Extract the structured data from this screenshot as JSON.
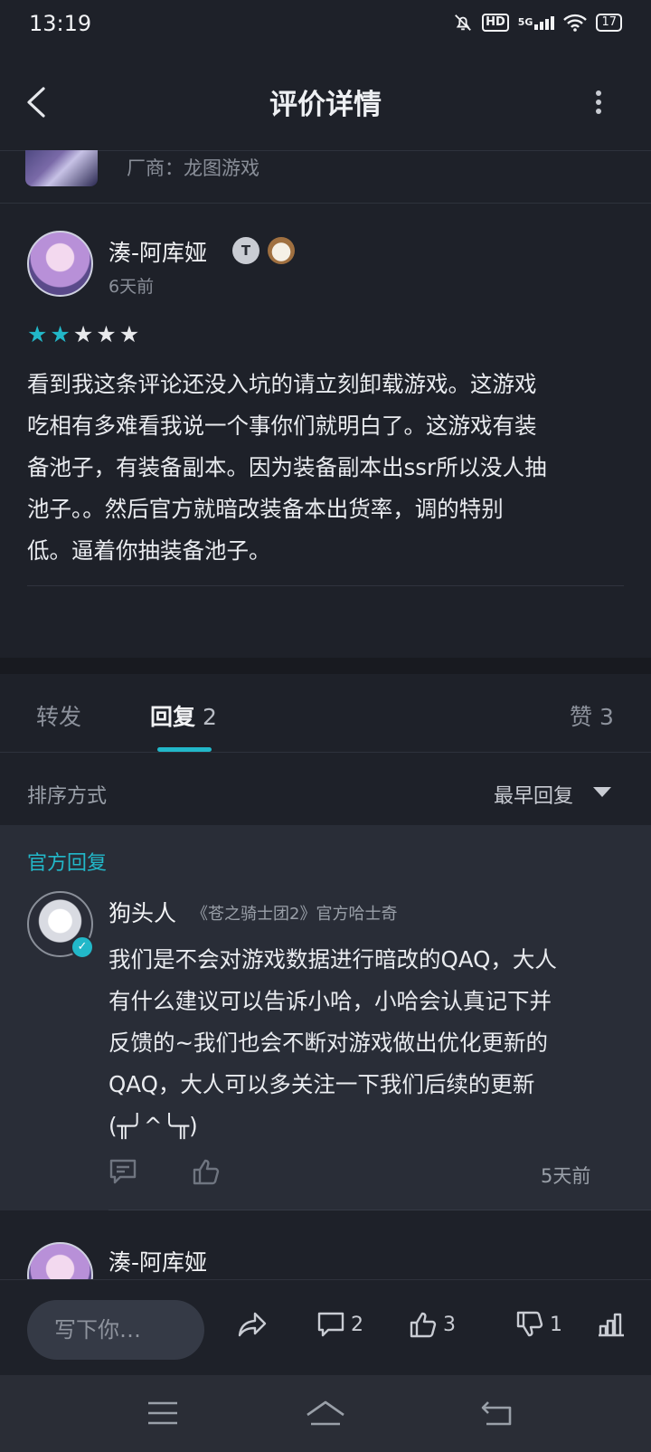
{
  "status_bar": {
    "time": "13:19",
    "hd": "HD",
    "network": "5G",
    "battery": "17"
  },
  "header": {
    "title": "评价详情"
  },
  "game": {
    "vendor": "厂商：龙图游戏"
  },
  "review": {
    "username": "湊-阿库娅",
    "badge": "T",
    "time": "6天前",
    "rating": 2,
    "max_rating": 5,
    "lines": [
      "看到我这条评论还没入坑的请立刻卸载游戏。这游戏",
      "吃相有多难看我说一个事你们就明白了。这游戏有装",
      "备池子，有装备副本。因为装备副本出ssr所以没人抽",
      "池子。。然后官方就暗改装备本出货率，调的特别",
      "低。逼着你抽装备池子。"
    ]
  },
  "tabs": {
    "forward": "转发",
    "reply": "回复",
    "reply_count": "2",
    "like": "赞",
    "like_count": "3"
  },
  "sort": {
    "label": "排序方式",
    "value": "最早回复"
  },
  "official_reply": {
    "section_label": "官方回复",
    "name": "狗头人",
    "title": "《苍之骑士团2》官方哈士奇",
    "lines": [
      "我们是不会对游戏数据进行暗改的QAQ，大人",
      "有什么建议可以告诉小哈，小哈会认真记下并",
      "反馈的~我们也会不断对游戏做出优化更新的",
      "QAQ，大人可以多关注一下我们后续的更新",
      "(╥╯^╰╥)"
    ],
    "time": "5天前"
  },
  "next_reply": {
    "name": "湊-阿库娅"
  },
  "bottom_bar": {
    "input_placeholder": "写下你…",
    "comment_count": "2",
    "like_count": "3",
    "dislike_count": "1"
  },
  "colors": {
    "accent": "#22b8c9",
    "background": "#1e2129",
    "official_bg": "#292d37"
  }
}
